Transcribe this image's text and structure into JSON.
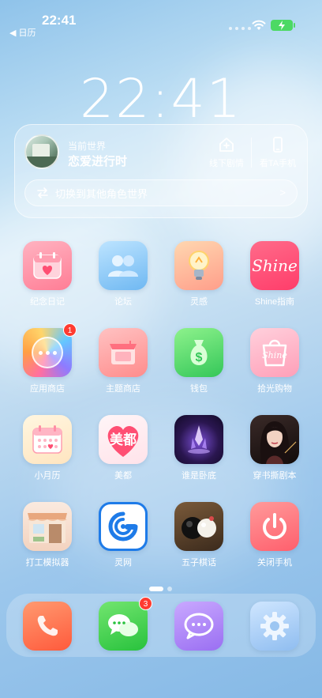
{
  "status": {
    "time": "22:41",
    "back_label": "日历"
  },
  "lock_clock": "22:41",
  "widget": {
    "label": "当前世界",
    "title": "恋爱进行时",
    "action1": "线下剧情",
    "action2": "看TA手机",
    "switch_label": "切换到其他角色世界",
    "switch_chevron": ">"
  },
  "apps": [
    {
      "label": "纪念日记",
      "icon": "calendar-heart-icon"
    },
    {
      "label": "论坛",
      "icon": "people-icon"
    },
    {
      "label": "灵感",
      "icon": "lightbulb-icon"
    },
    {
      "label": "Shine指南",
      "icon": "shine-logo-icon",
      "logo_text": "Shine"
    },
    {
      "label": "应用商店",
      "icon": "more-dots-icon",
      "badge": "1"
    },
    {
      "label": "主题商店",
      "icon": "shop-stand-icon"
    },
    {
      "label": "钱包",
      "icon": "money-bag-icon"
    },
    {
      "label": "拾光购物",
      "icon": "shopping-bag-icon",
      "logo_text": "Shine"
    },
    {
      "label": "小月历",
      "icon": "calendar-icon"
    },
    {
      "label": "美都",
      "icon": "heart-logo-icon",
      "logo_text": "美都"
    },
    {
      "label": "谁是卧底",
      "icon": "crystal-icon"
    },
    {
      "label": "穿书撕剧本",
      "icon": "portrait-icon"
    },
    {
      "label": "打工模拟器",
      "icon": "storefront-icon"
    },
    {
      "label": "灵网",
      "icon": "search-logo-icon"
    },
    {
      "label": "五子棋话",
      "icon": "go-stones-icon"
    },
    {
      "label": "关闭手机",
      "icon": "power-icon"
    }
  ],
  "dock": [
    {
      "name": "phone",
      "icon": "phone-icon"
    },
    {
      "name": "messages",
      "icon": "chat-bubbles-icon",
      "badge": "3"
    },
    {
      "name": "chat",
      "icon": "chat-bubble-icon"
    },
    {
      "name": "settings",
      "icon": "gear-icon"
    }
  ]
}
